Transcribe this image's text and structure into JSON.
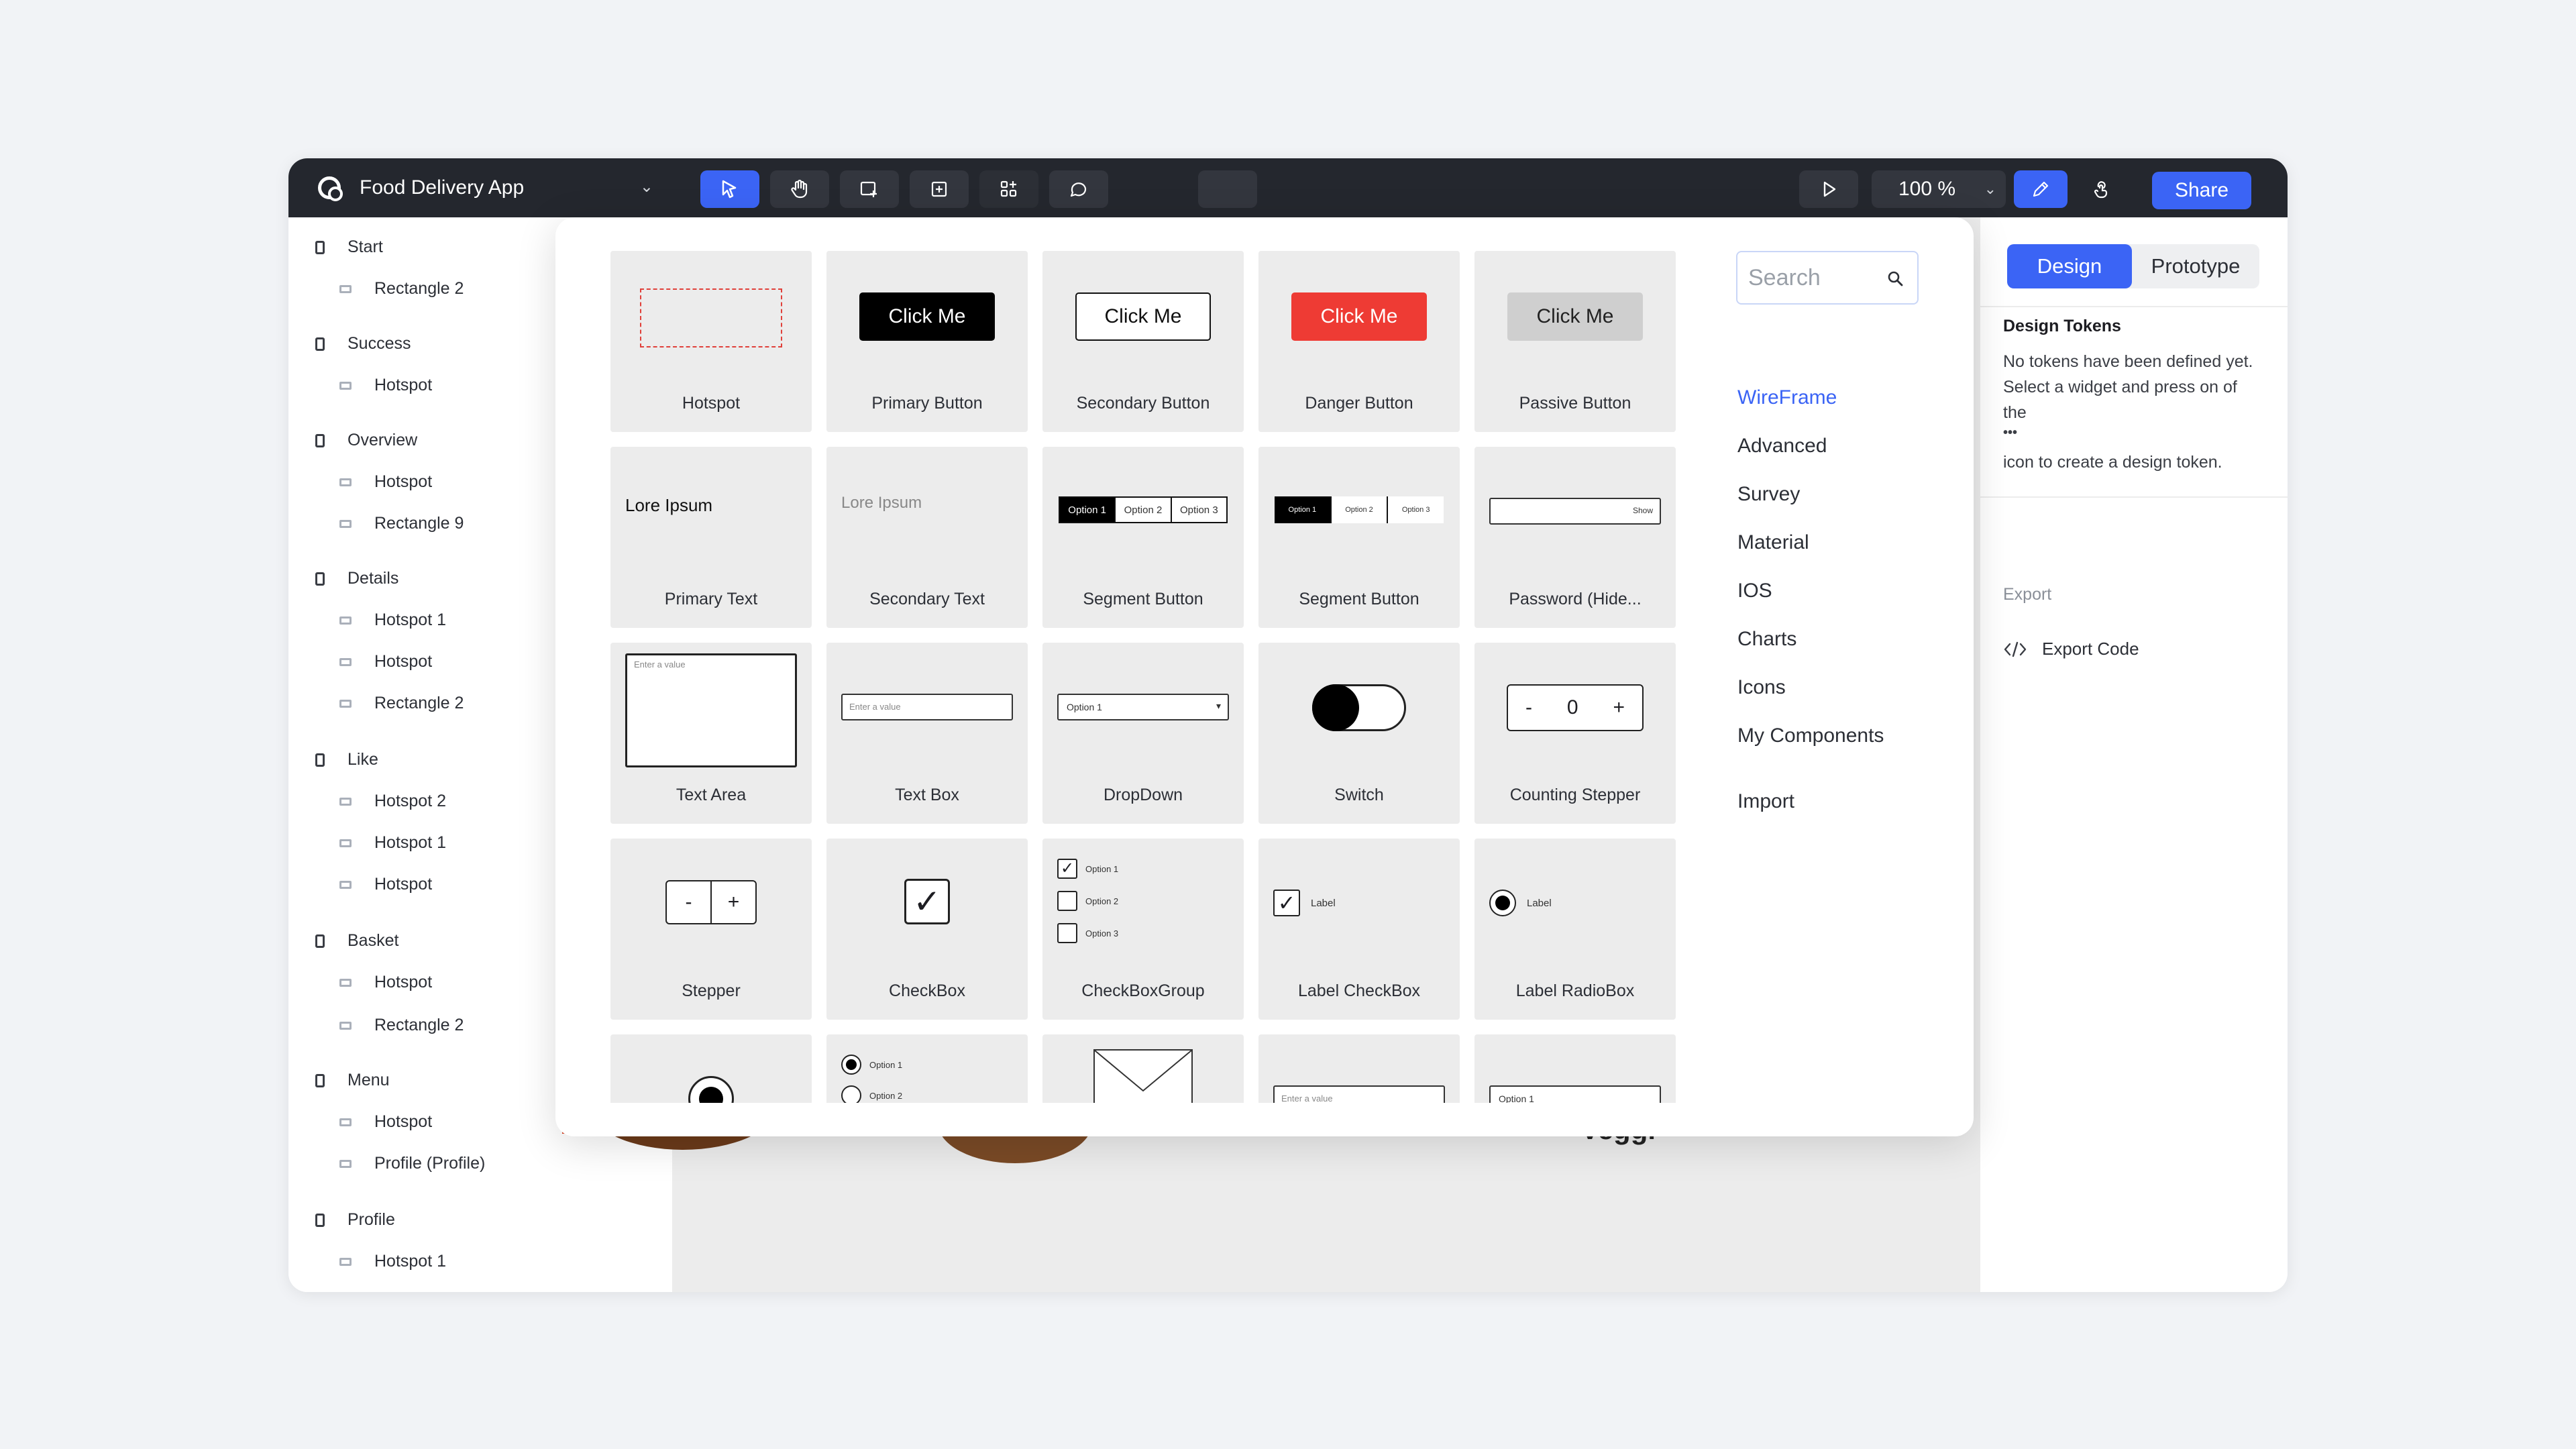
{
  "app": {
    "project_name": "Food Delivery App",
    "zoom": "100 %",
    "share_label": "Share"
  },
  "layers": [
    {
      "type": "screen",
      "label": "Start"
    },
    {
      "type": "child",
      "label": "Rectangle 2"
    },
    {
      "type": "screen",
      "label": "Success"
    },
    {
      "type": "child",
      "label": "Hotspot"
    },
    {
      "type": "screen",
      "label": "Overview"
    },
    {
      "type": "child",
      "label": "Hotspot"
    },
    {
      "type": "child",
      "label": "Rectangle 9"
    },
    {
      "type": "screen",
      "label": "Details"
    },
    {
      "type": "child",
      "label": "Hotspot 1"
    },
    {
      "type": "child",
      "label": "Hotspot"
    },
    {
      "type": "child",
      "label": "Rectangle 2"
    },
    {
      "type": "screen",
      "label": "Like"
    },
    {
      "type": "child",
      "label": "Hotspot 2"
    },
    {
      "type": "child",
      "label": "Hotspot 1"
    },
    {
      "type": "child",
      "label": "Hotspot"
    },
    {
      "type": "screen",
      "label": "Basket"
    },
    {
      "type": "child",
      "label": "Hotspot"
    },
    {
      "type": "child",
      "label": "Rectangle 2"
    },
    {
      "type": "screen",
      "label": "Menu"
    },
    {
      "type": "child",
      "label": "Hotspot"
    },
    {
      "type": "child",
      "label": "Profile (Profile)"
    },
    {
      "type": "screen",
      "label": "Profile"
    },
    {
      "type": "child",
      "label": "Hotspot 1"
    }
  ],
  "right_panel": {
    "tab_design": "Design",
    "tab_prototype": "Prototype",
    "tokens_title": "Design Tokens",
    "tokens_line1": "No tokens have been defined yet.",
    "tokens_line2": "Select a widget and press on of",
    "tokens_line3": "the",
    "tokens_dots": "•••",
    "tokens_line4": "icon to create a design token.",
    "export_title": "Export",
    "export_code": "Export Code"
  },
  "canvas": {
    "veggie_text": "Veggi"
  },
  "library": {
    "search_placeholder": "Search",
    "categories": [
      "WireFrame",
      "Advanced",
      "Survey",
      "Material",
      "IOS",
      "Charts",
      "Icons",
      "My Components",
      "Import"
    ],
    "selected_category": "WireFrame",
    "components": [
      {
        "label": "Hotspot"
      },
      {
        "label": "Primary Button",
        "preview": "Click Me"
      },
      {
        "label": "Secondary Button",
        "preview": "Click Me"
      },
      {
        "label": "Danger Button",
        "preview": "Click Me"
      },
      {
        "label": "Passive Button",
        "preview": "Click Me"
      },
      {
        "label": "Primary Text",
        "preview": "Lore Ipsum"
      },
      {
        "label": "Secondary Text",
        "preview": "Lore Ipsum"
      },
      {
        "label": "Segment Button",
        "options": [
          "Option 1",
          "Option 2",
          "Option 3"
        ]
      },
      {
        "label": "Segment Button",
        "options": [
          "Option 1",
          "Option 2",
          "Option 3"
        ]
      },
      {
        "label": "Password (Hide...",
        "preview": "Show"
      },
      {
        "label": "Text Area",
        "preview": "Enter a value"
      },
      {
        "label": "Text Box",
        "preview": "Enter a value"
      },
      {
        "label": "DropDown",
        "preview": "Option 1"
      },
      {
        "label": "Switch"
      },
      {
        "label": "Counting Stepper",
        "preview": "0",
        "minus": "-",
        "plus": "+"
      },
      {
        "label": "Stepper",
        "minus": "-",
        "plus": "+"
      },
      {
        "label": "CheckBox"
      },
      {
        "label": "CheckBoxGroup",
        "options": [
          "Option 1",
          "Option 2",
          "Option 3"
        ]
      },
      {
        "label": "Label CheckBox",
        "preview": "Label"
      },
      {
        "label": "Label RadioBox",
        "preview": "Label"
      },
      {
        "label": ""
      },
      {
        "label": "",
        "options": [
          "Option 1",
          "Option 2"
        ]
      },
      {
        "label": ""
      },
      {
        "label": "",
        "preview": "Enter a value"
      },
      {
        "label": "",
        "preview": "Option 1"
      }
    ]
  },
  "colors": {
    "accent": "#3b64f5",
    "topbar": "#24272e",
    "danger": "#ee3b34"
  }
}
